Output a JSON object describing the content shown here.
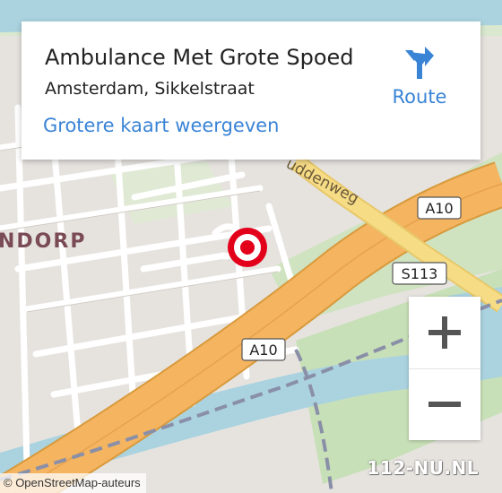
{
  "place": {
    "title": "Ambulance Met Grote Spoed",
    "subtitle": "Amsterdam, Sikkelstraat",
    "bigger_map_label": "Grotere kaart weergeven",
    "route_label": "Route"
  },
  "map": {
    "district_label": "NDORP",
    "street_label": "uddenweg",
    "road_shields": [
      "A10",
      "S113",
      "A10"
    ],
    "colors": {
      "water": "#aad3df",
      "motorway": "#f4b460",
      "motorway_casing": "#d89a3c",
      "residential": "#ffffff",
      "land": "#e6e3df",
      "green": "#cde6c0",
      "marker": "#e3001b",
      "link": "#3a84d6"
    }
  },
  "controls": {
    "zoom_in_symbol": "+",
    "zoom_out_symbol": "−"
  },
  "attribution": "© OpenStreetMap-auteurs",
  "watermark": "112-NU.NL"
}
